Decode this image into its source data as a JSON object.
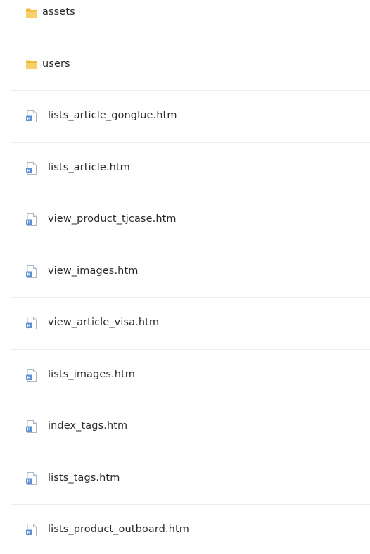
{
  "items": [
    {
      "type": "folder",
      "name": "assets",
      "icon": "folder-icon"
    },
    {
      "type": "folder",
      "name": "users",
      "icon": "folder-icon"
    },
    {
      "type": "file",
      "name": "lists_article_gonglue.htm",
      "icon": "html-file-icon"
    },
    {
      "type": "file",
      "name": "lists_article.htm",
      "icon": "html-file-icon"
    },
    {
      "type": "file",
      "name": "view_product_tjcase.htm",
      "icon": "html-file-icon"
    },
    {
      "type": "file",
      "name": "view_images.htm",
      "icon": "html-file-icon"
    },
    {
      "type": "file",
      "name": "view_article_visa.htm",
      "icon": "html-file-icon"
    },
    {
      "type": "file",
      "name": "lists_images.htm",
      "icon": "html-file-icon"
    },
    {
      "type": "file",
      "name": "index_tags.htm",
      "icon": "html-file-icon"
    },
    {
      "type": "file",
      "name": "lists_tags.htm",
      "icon": "html-file-icon"
    },
    {
      "type": "file",
      "name": "lists_product_outboard.htm",
      "icon": "html-file-icon"
    }
  ],
  "colors": {
    "folder": "#f4c24d",
    "file_accent": "#4a7fc1",
    "divider": "#ececec",
    "text": "#2b2b2b"
  }
}
